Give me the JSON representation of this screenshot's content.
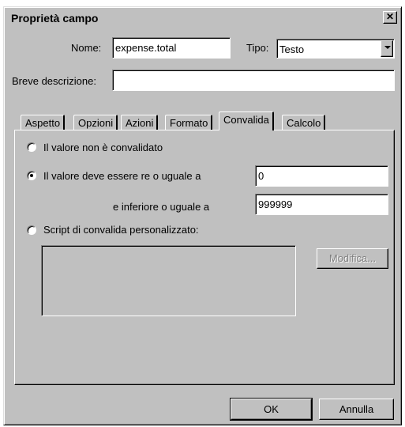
{
  "window": {
    "title": "Proprietà campo"
  },
  "form": {
    "name_label": "Nome:",
    "name_value": "expense.total",
    "type_label": "Tipo:",
    "type_value": "Testo",
    "desc_label": "Breve descrizione:",
    "desc_value": ""
  },
  "tabs": [
    {
      "label": "Aspetto"
    },
    {
      "label": "Opzioni"
    },
    {
      "label": "Azioni"
    },
    {
      "label": "Formato"
    },
    {
      "label": "Convalida",
      "active": true
    },
    {
      "label": "Calcolo"
    }
  ],
  "validation": {
    "option_none": "Il valore non è convalidato",
    "option_range": "Il valore deve essere  re o uguale a",
    "min_value": "0",
    "max_label": "e inferiore o uguale a",
    "max_value": "999999",
    "option_script": "Script di convalida personalizzato:",
    "selected": "range",
    "edit_button": "Modifica..."
  },
  "buttons": {
    "ok": "OK",
    "cancel": "Annulla"
  }
}
